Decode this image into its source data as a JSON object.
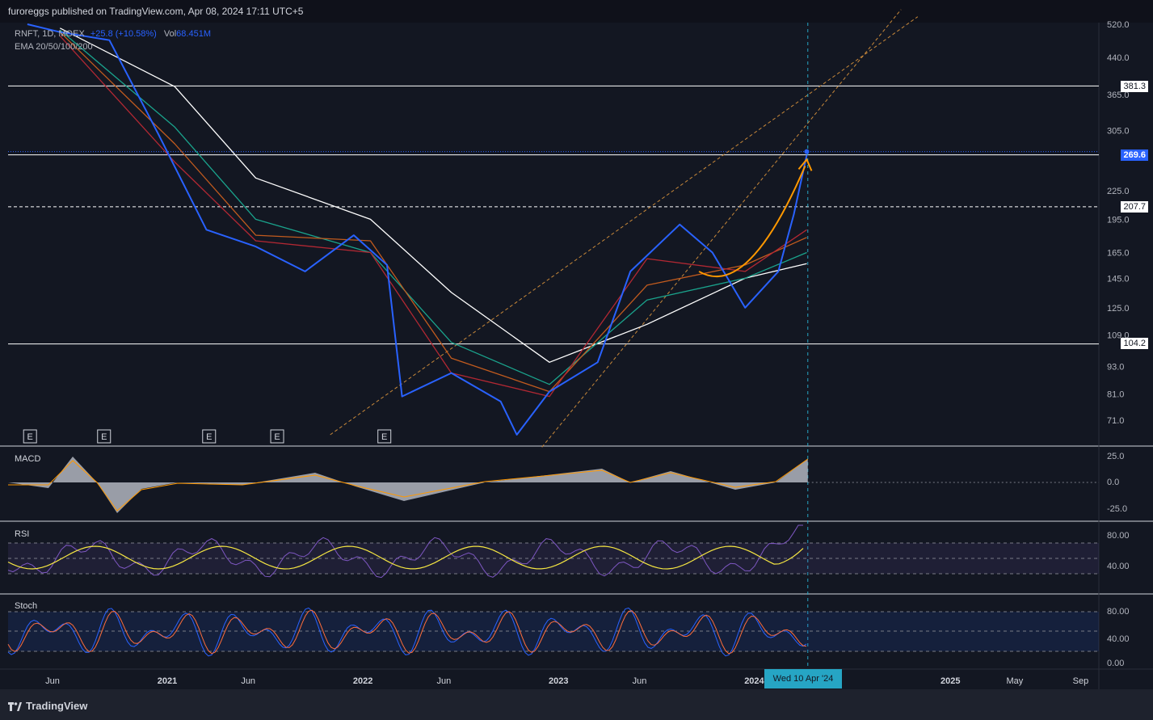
{
  "header": {
    "publisher": "furoreggs published on TradingView.com, Apr 08, 2024 17:11 UTC+5"
  },
  "legend": {
    "symbol": "RNFT, 1D, MOEX",
    "change": "+25.8 (+10.58%)",
    "vol": "Vol",
    "vol_value": "68.451M",
    "ema": "EMA 20/50/100/200"
  },
  "panes": {
    "macd": "MACD",
    "rsi": "RSI",
    "stoch": "Stoch"
  },
  "price_tags": {
    "tag1": "381.3",
    "tag2": "269.6",
    "tag3": "207.7",
    "tag4": "104.2"
  },
  "crosshair_date": "Wed 10 Apr '24",
  "footer": {
    "brand": "TradingView"
  },
  "earnings_marker": "E",
  "colors": {
    "price": "#2962ff",
    "ema20": "#b22833",
    "ema50": "#c25b1e",
    "ema100": "#1aa38c",
    "ema200": "#ffffff",
    "arrow": "#ff9800",
    "rsi": "#7e57c2",
    "rsi_ma": "#f5e642",
    "stoch_k": "#2962ff",
    "stoch_d": "#ff6d3a"
  },
  "chart_data": {
    "type": "line",
    "title": "",
    "y_scale": "log",
    "price_axis_ticks": [
      "520.0",
      "440.0",
      "365.0",
      "305.0",
      "225.0",
      "195.0",
      "165.0",
      "145.0",
      "125.0",
      "109.0",
      "93.0",
      "81.0",
      "71.0"
    ],
    "macd_axis_ticks": [
      "25.0",
      "0.0",
      "-25.0"
    ],
    "rsi_axis_ticks": [
      "80.00",
      "40.00"
    ],
    "stoch_axis_ticks": [
      "80.00",
      "40.00",
      "0.00"
    ],
    "x_ticks": [
      "Jun",
      "2021",
      "Jun",
      "2022",
      "Jun",
      "2023",
      "Jun",
      "2024",
      "2025",
      "May",
      "Sep"
    ],
    "horizontal_levels": [
      381.3,
      269.6,
      207.7,
      104.2
    ],
    "last_price": 269.6,
    "series": [
      {
        "name": "RNFT",
        "x": [
          "2020-04",
          "2020-06",
          "2020-09",
          "2020-12",
          "2021-03",
          "2021-06",
          "2021-09",
          "2021-12",
          "2022-02",
          "2022-03",
          "2022-06",
          "2022-09",
          "2022-10",
          "2022-12",
          "2023-03",
          "2023-05",
          "2023-08",
          "2023-10",
          "2023-12",
          "2024-02",
          "2024-03",
          "2024-04-08"
        ],
        "values": [
          520,
          500,
          480,
          300,
          185,
          170,
          150,
          180,
          155,
          80,
          90,
          78,
          66,
          82,
          95,
          150,
          190,
          165,
          125,
          150,
          200,
          269.6
        ]
      },
      {
        "name": "EMA 20",
        "x": [
          "2020-06",
          "2021-01",
          "2021-06",
          "2022-01",
          "2022-06",
          "2022-12",
          "2023-06",
          "2023-12",
          "2024-04-08"
        ],
        "values": [
          490,
          260,
          175,
          165,
          90,
          80,
          160,
          150,
          185
        ]
      },
      {
        "name": "EMA 50",
        "x": [
          "2020-06",
          "2021-01",
          "2021-06",
          "2022-01",
          "2022-06",
          "2022-12",
          "2023-06",
          "2023-12",
          "2024-04-08"
        ],
        "values": [
          500,
          285,
          180,
          175,
          97,
          82,
          140,
          155,
          178
        ]
      },
      {
        "name": "EMA 100",
        "x": [
          "2020-06",
          "2021-01",
          "2021-06",
          "2022-01",
          "2022-06",
          "2022-12",
          "2023-06",
          "2023-12",
          "2024-04-08"
        ],
        "values": [
          505,
          310,
          195,
          165,
          105,
          85,
          130,
          145,
          165
        ]
      },
      {
        "name": "EMA 200",
        "x": [
          "2020-06",
          "2021-01",
          "2021-06",
          "2022-01",
          "2022-06",
          "2022-12",
          "2023-06",
          "2023-12",
          "2024-04-08"
        ],
        "values": [
          510,
          380,
          240,
          195,
          135,
          95,
          115,
          145,
          156
        ]
      }
    ]
  }
}
